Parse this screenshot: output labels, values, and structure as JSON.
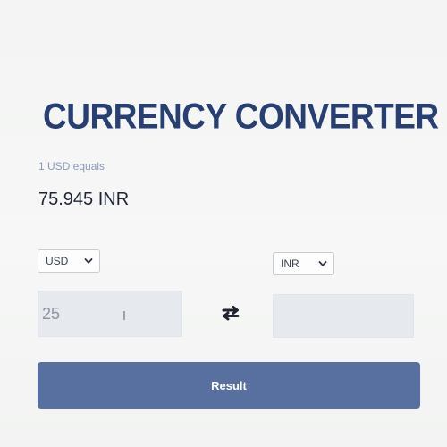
{
  "app": {
    "title": "CURRENCY CONVERTER"
  },
  "rate": {
    "label": "1 USD equals",
    "value": "75.945 INR"
  },
  "from": {
    "currency": "USD",
    "amount": "25"
  },
  "to": {
    "currency": "INR",
    "amount": ""
  },
  "actions": {
    "result_label": "Result"
  },
  "icons": {
    "swap": "swap-arrows-icon",
    "dropdown": "chevron-down-icon"
  },
  "colors": {
    "title": "#283f74",
    "button": "#5770a0",
    "input_bg": "#e6e9ed"
  }
}
